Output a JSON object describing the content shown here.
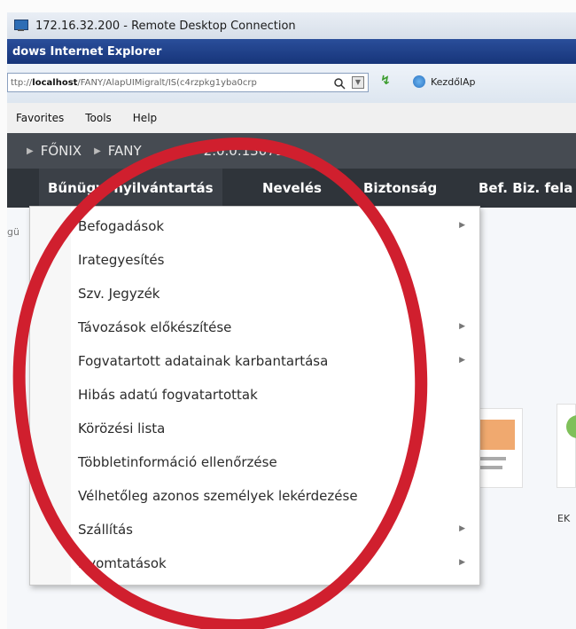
{
  "window": {
    "rdc_title": "172.16.32.200 - Remote Desktop Connection",
    "ie_title": "dows Internet Explorer"
  },
  "address": {
    "prefix": "ttp://",
    "host": "localhost",
    "path": "/FANY/AlapUIMigralt/IS(c4rzpkg1yba0crp",
    "tab_label": "KezdőlAp"
  },
  "menubar": [
    "Favorites",
    "Tools",
    "Help"
  ],
  "breadcrumb": {
    "item1": "FŐNIX",
    "item2": "FANY",
    "version": "2.0.0.130718"
  },
  "nav": [
    "Bűnügyi nyilvántartás",
    "Nevelés",
    "Biztonság",
    "Bef. Biz. fela"
  ],
  "dropdown": [
    {
      "label": "Befogadások",
      "submenu": true
    },
    {
      "label": "Irategyesítés",
      "submenu": false
    },
    {
      "label": "Szv. Jegyzék",
      "submenu": false
    },
    {
      "label": "Távozások előkészítése",
      "submenu": true
    },
    {
      "label": "Fogvatartott adatainak karbantartása",
      "submenu": true
    },
    {
      "label": "Hibás adatú fogvatartottak",
      "submenu": false
    },
    {
      "label": "Körözési lista",
      "submenu": false
    },
    {
      "label": "Többletinformáció ellenőrzése",
      "submenu": false
    },
    {
      "label": "Vélhetőleg azonos személyek lekérdezése",
      "submenu": false
    },
    {
      "label": "Szállítás",
      "submenu": true
    },
    {
      "label": "Nyomtatások",
      "submenu": true
    }
  ],
  "background": {
    "side_fragment": "gü",
    "card_label": "EK"
  },
  "colors": {
    "annotation": "#d01f2e",
    "nav_bar": "#2f343a",
    "breadcrumb_bar": "#464b52"
  }
}
